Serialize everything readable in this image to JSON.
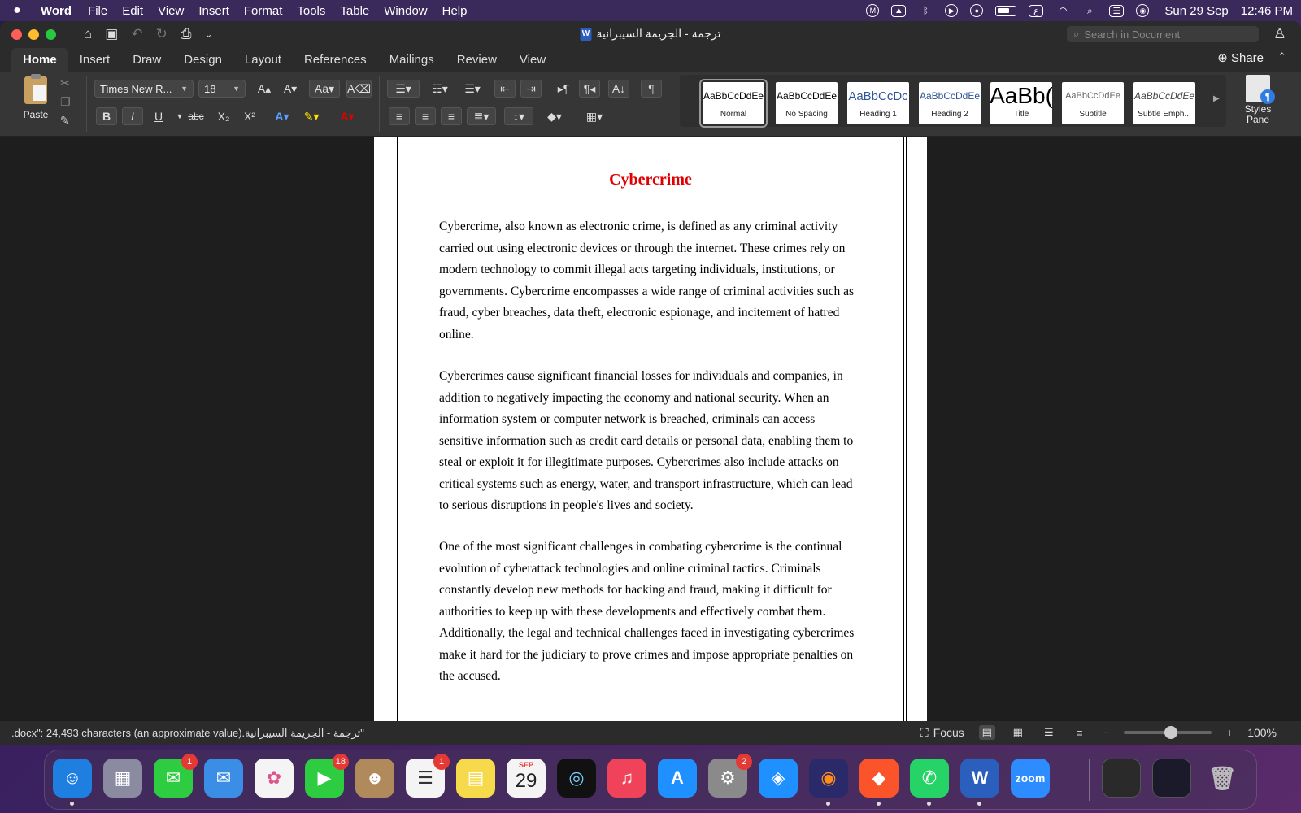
{
  "menubar": {
    "app_name": "Word",
    "items": [
      "File",
      "Edit",
      "View",
      "Insert",
      "Format",
      "Tools",
      "Table",
      "Window",
      "Help"
    ],
    "input_source": "ع",
    "date": "Sun 29 Sep",
    "time": "12:46 PM"
  },
  "window": {
    "doc_title": "ترجمة - الجريمة السيبرانية",
    "search_placeholder": "Search in Document",
    "share_label": "Share"
  },
  "tabs": [
    "Home",
    "Insert",
    "Draw",
    "Design",
    "Layout",
    "References",
    "Mailings",
    "Review",
    "View"
  ],
  "active_tab": "Home",
  "ribbon": {
    "paste_label": "Paste",
    "font_name": "Times New R...",
    "font_size": "18",
    "bold": "B",
    "italic": "I",
    "underline": "U",
    "strike": "abc",
    "styles": [
      {
        "sample": "AaBbCcDdEe",
        "name": "Normal"
      },
      {
        "sample": "AaBbCcDdEe",
        "name": "No Spacing"
      },
      {
        "sample": "AaBbCcDc",
        "name": "Heading 1"
      },
      {
        "sample": "AaBbCcDdEe",
        "name": "Heading 2"
      },
      {
        "sample": "AaBb(",
        "name": "Title"
      },
      {
        "sample": "AaBbCcDdEe",
        "name": "Subtitle"
      },
      {
        "sample": "AaBbCcDdEe",
        "name": "Subtle Emph..."
      }
    ],
    "styles_pane_label": "Styles Pane"
  },
  "document": {
    "heading": "Cybercrime",
    "paragraphs": [
      "Cybercrime, also known as electronic crime, is defined as any criminal activity carried out using electronic devices or through the internet. These crimes rely on modern technology to commit illegal acts targeting individuals, institutions, or governments. Cybercrime encompasses a wide range of criminal activities such as fraud, cyber breaches, data theft, electronic espionage, and incitement of hatred online.",
      "Cybercrimes cause significant financial losses for individuals and companies, in addition to negatively impacting the economy and national security. When an information system or computer network is breached, criminals can access sensitive information such as credit card details or personal data, enabling them to steal or exploit it for illegitimate purposes. Cybercrimes also include attacks on critical systems such as energy, water, and transport infrastructure, which can lead to serious disruptions in people's lives and society.",
      "One of the most significant challenges in combating cybercrime is the continual evolution of cyberattack technologies and online criminal tactics. Criminals constantly develop new methods for hacking and fraud, making it difficult for authorities to keep up with these developments and effectively combat them. Additionally, the legal and technical challenges faced in investigating cybercrimes make it hard for the judiciary to prove crimes and impose appropriate penalties on the accused."
    ]
  },
  "statusbar": {
    "text": ".docx\": 24,493 characters (an approximate value).ترجمة - الجريمة السيبرانية\"",
    "focus_label": "Focus",
    "zoom": "100%"
  },
  "dock": {
    "apps": [
      {
        "name": "Finder",
        "color": "#1e7fe0",
        "glyph": "☺",
        "badge": ""
      },
      {
        "name": "Launchpad",
        "color": "#8a8aa0",
        "glyph": "▦",
        "badge": ""
      },
      {
        "name": "Messages",
        "color": "#2ecc40",
        "glyph": "✉",
        "badge": "1"
      },
      {
        "name": "Mail",
        "color": "#3a8ee6",
        "glyph": "✉",
        "badge": ""
      },
      {
        "name": "Photos",
        "color": "#f4f4f4",
        "glyph": "✿",
        "badge": ""
      },
      {
        "name": "FaceTime",
        "color": "#2ecc40",
        "glyph": "▶",
        "badge": "18"
      },
      {
        "name": "Contacts",
        "color": "#b08a5a",
        "glyph": "☻",
        "badge": ""
      },
      {
        "name": "Reminders",
        "color": "#f4f4f4",
        "glyph": "☰",
        "badge": "1"
      },
      {
        "name": "Notes",
        "color": "#f7d94c",
        "glyph": "▤",
        "badge": ""
      },
      {
        "name": "Calendar",
        "color": "#f4f4f4",
        "glyph": "",
        "badge": ""
      },
      {
        "name": "Activity",
        "color": "#111",
        "glyph": "◎",
        "badge": ""
      },
      {
        "name": "Music",
        "color": "#f0435a",
        "glyph": "♫",
        "badge": ""
      },
      {
        "name": "App Store",
        "color": "#1e90ff",
        "glyph": "A",
        "badge": ""
      },
      {
        "name": "System Settings",
        "color": "#8a8a8a",
        "glyph": "⚙",
        "badge": "2"
      },
      {
        "name": "Safari",
        "color": "#1e90ff",
        "glyph": "◈",
        "badge": ""
      },
      {
        "name": "Firefox",
        "color": "#2a2a6a",
        "glyph": "◉",
        "badge": ""
      },
      {
        "name": "Brave",
        "color": "#fb542b",
        "glyph": "◆",
        "badge": ""
      },
      {
        "name": "WhatsApp",
        "color": "#25d366",
        "glyph": "✆",
        "badge": ""
      },
      {
        "name": "Word",
        "color": "#2b5fbd",
        "glyph": "W",
        "badge": ""
      },
      {
        "name": "Zoom",
        "color": "#2d8cff",
        "glyph": "zoom",
        "badge": ""
      }
    ],
    "calendar_month": "SEP",
    "calendar_day": "29"
  }
}
